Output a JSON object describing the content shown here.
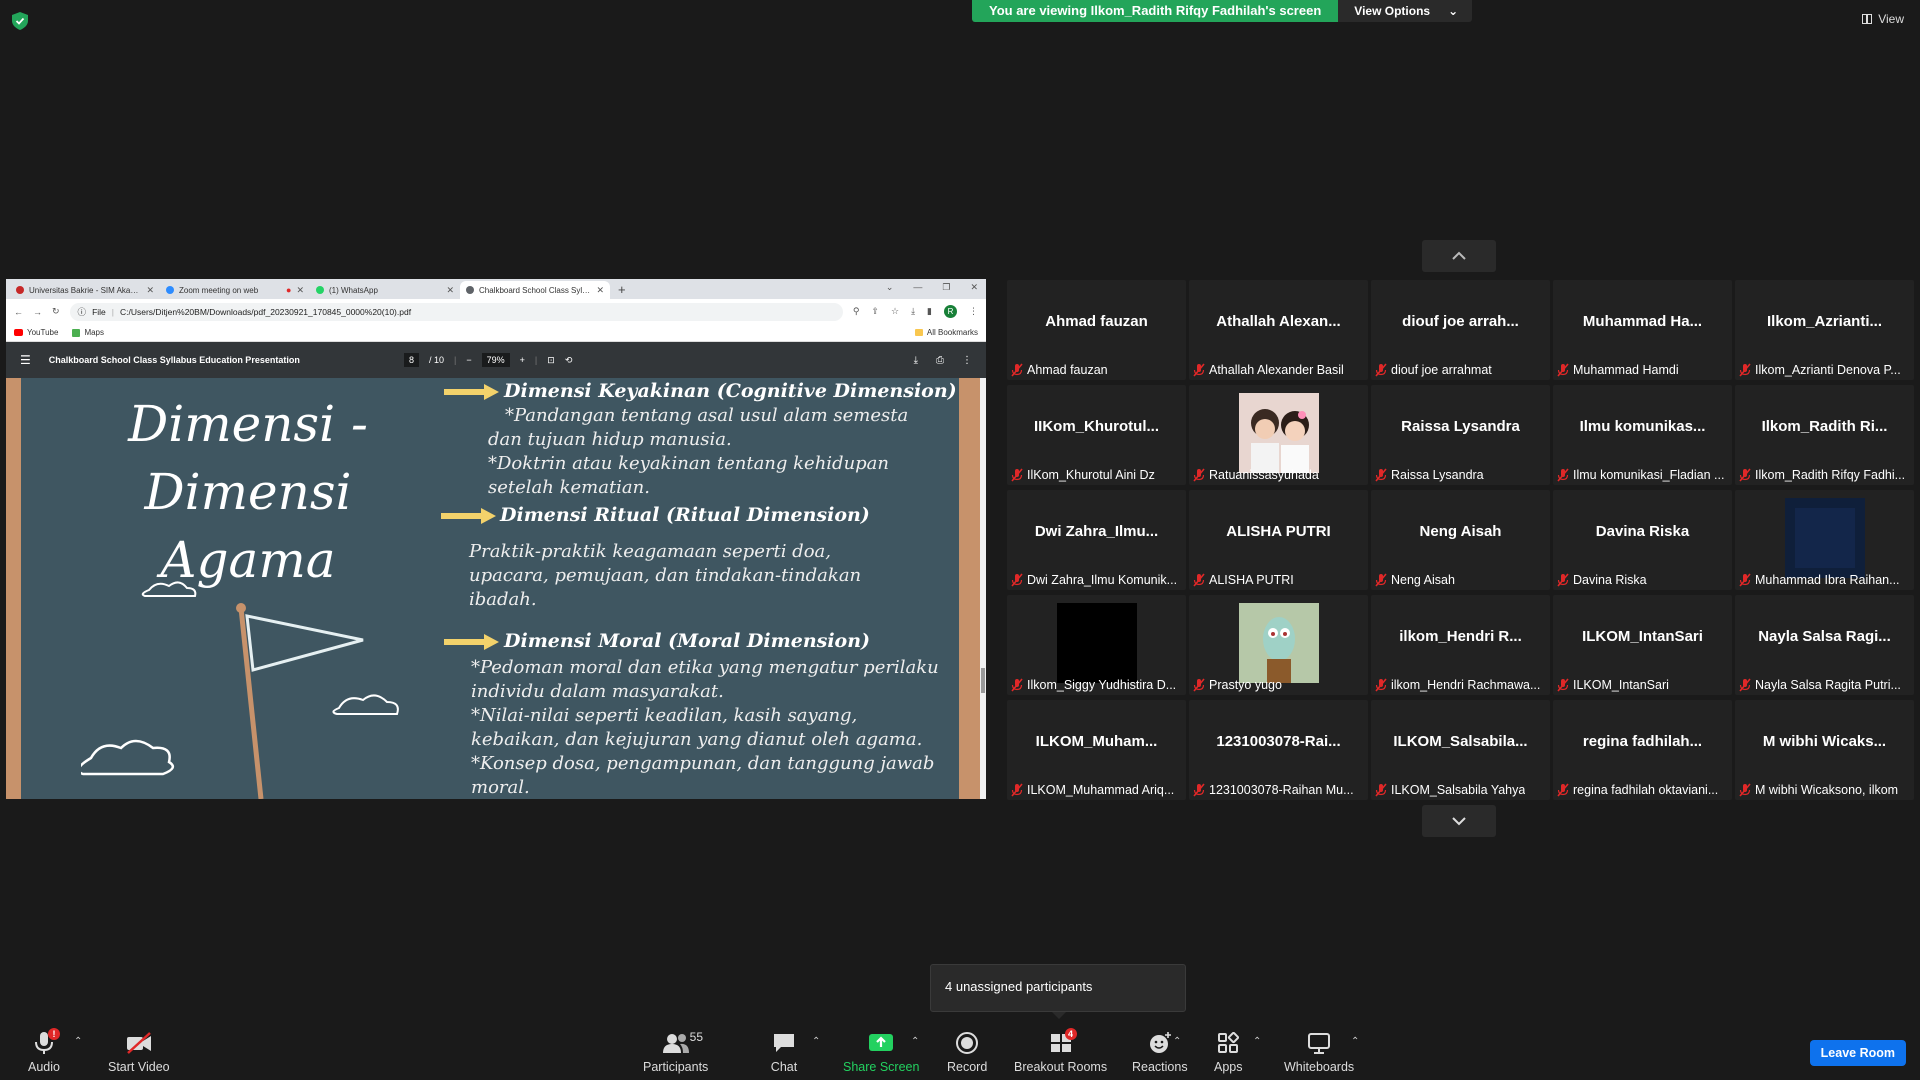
{
  "banner": {
    "viewing_text": "You are viewing Ilkom_Radith Rifqy Fadhilah's screen",
    "view_options": "View Options",
    "view_label": "View"
  },
  "browser": {
    "tabs": [
      {
        "label": "Universitas Bakrie - SIM Akademi",
        "active": false,
        "color": "#c62828"
      },
      {
        "label": "Zoom meeting on web",
        "active": false,
        "color": "#2d8cff"
      },
      {
        "label": "(1) WhatsApp",
        "active": false,
        "color": "#25d366"
      },
      {
        "label": "Chalkboard School Class Syllab...",
        "active": true,
        "color": "#5f6368"
      }
    ],
    "address_prefix": "File",
    "address": "C:/Users/Ditjen%20BM/Downloads/pdf_20230921_170845_0000%20(10).pdf",
    "bookmarks": [
      "YouTube",
      "Maps"
    ],
    "all_bookmarks": "All Bookmarks",
    "avatar_letter": "R"
  },
  "pdf": {
    "title": "Chalkboard School Class Syllabus Education Presentation",
    "page_current": "8",
    "page_total": "/ 10",
    "zoom": "79%"
  },
  "slide": {
    "title_line1": "Dimensi - Dimensi",
    "title_line2": "Agama",
    "h1": "Dimensi Keyakinan (Cognitive Dimension)",
    "b1_1": "*Pandangan tentang asal usul alam semesta",
    "b1_2": "dan tujuan hidup manusia.",
    "b1_3": "*Doktrin atau keyakinan tentang kehidupan",
    "b1_4": "setelah kematian.",
    "h2": "Dimensi Ritual (Ritual Dimension)",
    "b2_1": "Praktik-praktik keagamaan seperti doa,",
    "b2_2": "upacara, pemujaan, dan tindakan-tindakan",
    "b2_3": "ibadah.",
    "h3": "Dimensi Moral (Moral Dimension)",
    "b3_1": "*Pedoman moral dan etika yang mengatur perilaku",
    "b3_2": "individu dalam masyarakat.",
    "b3_3": "*Nilai-nilai seperti keadilan, kasih sayang,",
    "b3_4": "kebaikan, dan kejujuran yang dianut oleh agama.",
    "b3_5": "*Konsep dosa, pengampunan, dan tanggung jawab",
    "b3_6": "moral."
  },
  "participants_tiles": [
    {
      "name": "Ahmad fauzan",
      "label": "Ahmad fauzan"
    },
    {
      "name": "Athallah Alexan...",
      "label": "Athallah Alexander Basil"
    },
    {
      "name": "diouf joe arrah...",
      "label": "diouf joe arrahmat"
    },
    {
      "name": "Muhammad Ha...",
      "label": "Muhammad Hamdi"
    },
    {
      "name": "Ilkom_Azrianti...",
      "label": "Ilkom_Azrianti Denova P..."
    },
    {
      "name": "IIKom_Khurotul...",
      "label": "IlKom_Khurotul Aini Dz"
    },
    {
      "name": "",
      "label": "Ratuanissasyuhada",
      "image": "photo-girls"
    },
    {
      "name": "Raissa Lysandra",
      "label": "Raissa Lysandra"
    },
    {
      "name": "Ilmu komunikas...",
      "label": "Ilmu komunikasi_Fladian ..."
    },
    {
      "name": "Ilkom_Radith Ri...",
      "label": "Ilkom_Radith Rifqy Fadhi..."
    },
    {
      "name": "Dwi Zahra_Ilmu...",
      "label": "Dwi Zahra_Ilmu Komunik..."
    },
    {
      "name": "ALISHA PUTRI",
      "label": "ALISHA PUTRI"
    },
    {
      "name": "Neng Aisah",
      "label": "Neng Aisah"
    },
    {
      "name": "Davina Riska",
      "label": "Davina Riska"
    },
    {
      "name": "",
      "label": "Muhammad Ibra Raihan...",
      "image": "blue-photo"
    },
    {
      "name": "",
      "label": "Ilkom_Siggy Yudhistira D...",
      "image": "black-photo"
    },
    {
      "name": "",
      "label": "Prastyo yugo",
      "image": "cartoon-photo"
    },
    {
      "name": "ilkom_Hendri R...",
      "label": "ilkom_Hendri Rachmawa..."
    },
    {
      "name": "ILKOM_IntanSari",
      "label": "ILKOM_IntanSari"
    },
    {
      "name": "Nayla Salsa Ragi...",
      "label": "Nayla Salsa Ragita Putri..."
    },
    {
      "name": "ILKOM_Muham...",
      "label": "ILKOM_Muhammad Ariq..."
    },
    {
      "name": "1231003078-Rai...",
      "label": "1231003078-Raihan Mu..."
    },
    {
      "name": "ILKOM_Salsabila...",
      "label": "ILKOM_Salsabila Yahya"
    },
    {
      "name": "regina fadhilah...",
      "label": "regina fadhilah oktaviani..."
    },
    {
      "name": "M wibhi Wicaks...",
      "label": "M wibhi Wicaksono, ilkom"
    }
  ],
  "popup": {
    "text": "4 unassigned participants"
  },
  "toolbar": {
    "audio": "Audio",
    "audio_badge": "!",
    "start_video": "Start Video",
    "participants": "Participants",
    "participants_count": "55",
    "chat": "Chat",
    "share_screen": "Share Screen",
    "record": "Record",
    "breakout_rooms": "Breakout Rooms",
    "breakout_badge": "4",
    "reactions": "Reactions",
    "apps": "Apps",
    "whiteboards": "Whiteboards",
    "leave_room": "Leave Room"
  },
  "colors": {
    "banner_green": "#23a55a",
    "share_green": "#23d160",
    "leave_blue": "#0e72ed",
    "muted_red": "#e02828",
    "chalkboard": "#3f5661"
  }
}
